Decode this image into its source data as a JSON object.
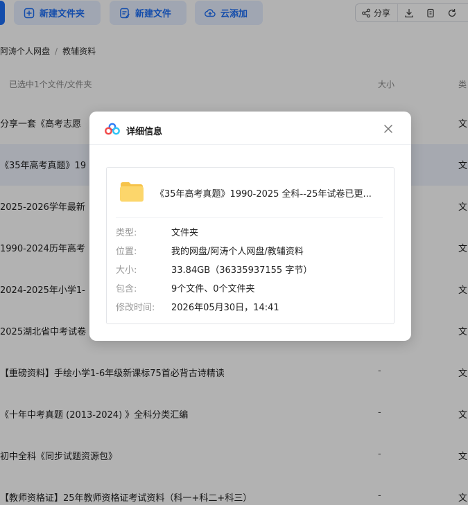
{
  "toolbar": {
    "new_folder": "新建文件夹",
    "new_file": "新建文件",
    "cloud_add": "云添加",
    "share": "分享"
  },
  "breadcrumb": {
    "root": "阿涛个人网盘",
    "separator": "/",
    "current": "教辅资料"
  },
  "table": {
    "selected_text": "已选中1个文件/文件夹",
    "col_size": "大小",
    "col_type": "类",
    "rows": [
      {
        "name": "分享一套《高考志愿",
        "size": "",
        "type": "文"
      },
      {
        "name": "《35年高考真题》19",
        "size": "",
        "type": "文"
      },
      {
        "name": "2025-2026学年最新",
        "size": "",
        "type": "文"
      },
      {
        "name": "1990-2024历年高考",
        "size": "",
        "type": "文"
      },
      {
        "name": "2024-2025年小学1-",
        "size": "",
        "type": "文"
      },
      {
        "name": "2025湖北省中考试卷",
        "size": "",
        "type": "文"
      },
      {
        "name": "【重磅资料】手绘小学1-6年级新课标75首必背古诗精读",
        "size": "-",
        "type": "文"
      },
      {
        "name": "《十年中考真题 (2013-2024) 》全科分类汇编",
        "size": "-",
        "type": "文"
      },
      {
        "name": "初中全科《同步试题资源包》",
        "size": "-",
        "type": "文"
      },
      {
        "name": "【教师资格证】25年教师资格证考试资料（科一+科二+科三）",
        "size": "-",
        "type": "文"
      }
    ]
  },
  "dialog": {
    "title": "详细信息",
    "file_name": "《35年高考真题》1990-2025 全科--25年试卷已更...",
    "fields": [
      {
        "label": "类型:",
        "value": "文件夹"
      },
      {
        "label": "位置:",
        "value": "我的网盘/阿涛个人网盘/教辅资料"
      },
      {
        "label": "大小:",
        "value": "33.84GB（36335937155 字节）"
      },
      {
        "label": "包含:",
        "value": "9个文件、0个文件夹"
      },
      {
        "label": "修改时间:",
        "value": "2026年05月30日，14:41"
      }
    ]
  },
  "colors": {
    "accent": "#1e6ff5",
    "button_bg": "#e5eeff",
    "folder": "#fcd66b",
    "overlay": "rgba(0,0,0,0.30)"
  },
  "icons": [
    "new-folder-icon",
    "new-file-icon",
    "cloud-upload-icon",
    "share-icon",
    "download-icon",
    "copy-icon",
    "refresh-icon",
    "baidu-netdisk-logo",
    "close-icon",
    "folder-icon"
  ]
}
